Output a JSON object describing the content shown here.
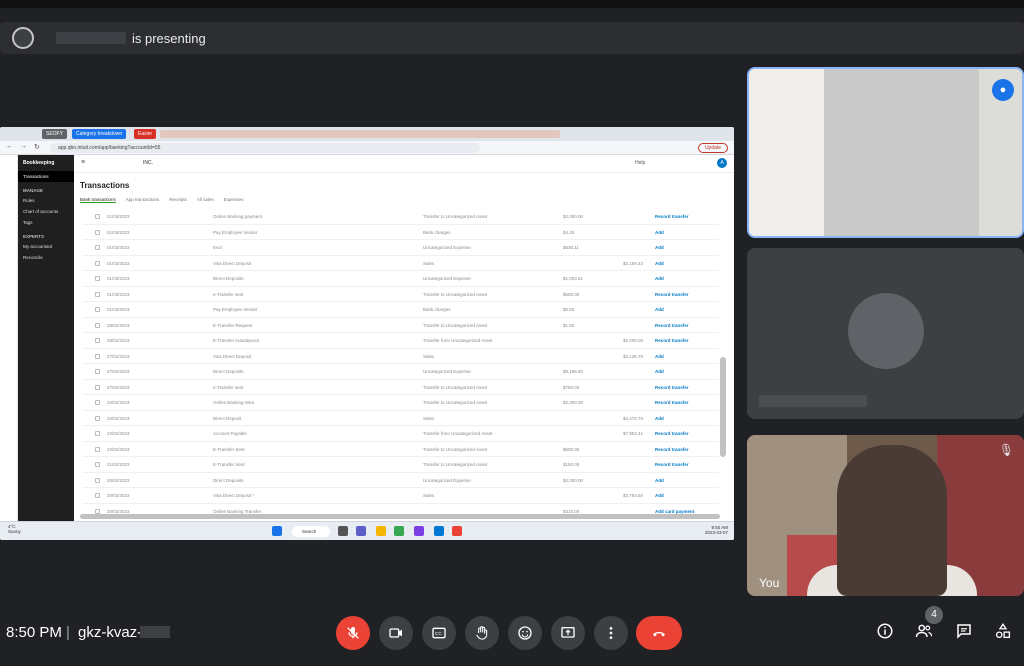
{
  "presenter": {
    "suffix": "is presenting"
  },
  "browser": {
    "tabs": [
      "SEOFY",
      "Category breakdown",
      "Easier"
    ],
    "url": "app.qbo.intuit.com/app/banking?accountId=55",
    "update_label": "Update"
  },
  "app": {
    "sidebar_title": "Bookkeeping",
    "sidebar_items": [
      "Transactions",
      "MANAGE",
      "Rules",
      "Chart of accounts",
      "Tags",
      "EXPERTS",
      "My accountant",
      "Reconcile"
    ],
    "company": "INC.",
    "help": "Help",
    "page_title": "Transactions",
    "subtabs": [
      "Bank transactions",
      "App transactions",
      "Receipts",
      "All sales",
      "Expenses"
    ],
    "rows": [
      {
        "date": "01/03/2023",
        "desc": "Online Banking payment",
        "cat": "Transfer to Uncategorized Asset",
        "spent": "$2,000.00",
        "recv": "",
        "action": "Record transfer"
      },
      {
        "date": "01/03/2023",
        "desc": "Pay Employee Vendor",
        "cat": "Bank charges",
        "spent": "$4.25",
        "recv": "",
        "action": "Add"
      },
      {
        "date": "01/03/2023",
        "desc": "Evol",
        "cat": "Uncategorized Expense",
        "spent": "$838.11",
        "recv": "",
        "action": "Add"
      },
      {
        "date": "01/03/2023",
        "desc": "Visa Direct Deposit",
        "cat": "Sales",
        "spent": "",
        "recv": "$2,159.43",
        "action": "Add"
      },
      {
        "date": "01/03/2023",
        "desc": "Direct Deposits",
        "cat": "Uncategorized Expense",
        "spent": "$1,003.61",
        "recv": "",
        "action": "Add"
      },
      {
        "date": "01/03/2023",
        "desc": "e-Transfer sent",
        "cat": "Transfer to Uncategorized Asset",
        "spent": "$600.00",
        "recv": "",
        "action": "Record transfer"
      },
      {
        "date": "01/03/2023",
        "desc": "Pay Employee Vendor",
        "cat": "Bank charges",
        "spent": "$0.83",
        "recv": "",
        "action": "Add"
      },
      {
        "date": "28/02/2023",
        "desc": "E-Transfer Request",
        "cat": "Transfer to Uncategorized Asset",
        "spent": "$1.50",
        "recv": "",
        "action": "Record transfer"
      },
      {
        "date": "28/02/2023",
        "desc": "E-Transfer Autodeposit",
        "cat": "Transfer from Uncategorized Asset",
        "spent": "",
        "recv": "$2,000.00",
        "action": "Record transfer"
      },
      {
        "date": "27/02/2023",
        "desc": "Visa Direct Deposit",
        "cat": "Sales",
        "spent": "",
        "recv": "$3,136.78",
        "action": "Add"
      },
      {
        "date": "27/02/2023",
        "desc": "Direct Deposits",
        "cat": "Uncategorized Expense",
        "spent": "$9,186.80",
        "recv": "",
        "action": "Add"
      },
      {
        "date": "27/02/2023",
        "desc": "e-Transfer sent",
        "cat": "Transfer to Uncategorized Asset",
        "spent": "$750.00",
        "recv": "",
        "action": "Record transfer"
      },
      {
        "date": "24/02/2023",
        "desc": "Online Banking Wea",
        "cat": "Transfer to Uncategorized Asset",
        "spent": "$2,000.00",
        "recv": "",
        "action": "Record transfer"
      },
      {
        "date": "24/02/2023",
        "desc": "Direct Deposit",
        "cat": "Sales",
        "spent": "",
        "recv": "$4,470.76",
        "action": "Add"
      },
      {
        "date": "22/02/2023",
        "desc": "Account Payable",
        "cat": "Transfer from Uncategorized Asset",
        "spent": "",
        "recv": "$7,953.41",
        "action": "Record transfer"
      },
      {
        "date": "22/02/2023",
        "desc": "E-Transfer Sent",
        "cat": "Transfer to Uncategorized Asset",
        "spent": "$600.00",
        "recv": "",
        "action": "Record transfer"
      },
      {
        "date": "21/02/2023",
        "desc": "E-Transfer Sent",
        "cat": "Transfer to Uncategorized Asset",
        "spent": "$150.00",
        "recv": "",
        "action": "Record transfer"
      },
      {
        "date": "20/02/2023",
        "desc": "Direct Deposits",
        "cat": "Uncategorized Expense",
        "spent": "$2,000.00",
        "recv": "",
        "action": "Add"
      },
      {
        "date": "20/02/2023",
        "desc": "Visa Direct Deposit *",
        "cat": "Sales",
        "spent": "",
        "recv": "$3,754.60",
        "action": "Add"
      },
      {
        "date": "20/02/2023",
        "desc": "Online Banking Transfer",
        "cat": "",
        "spent": "$310.00",
        "recv": "",
        "action": "Add card payment"
      }
    ]
  },
  "taskbar": {
    "temp": "4°C",
    "weather": "Sunny",
    "search": "Search",
    "clock_time": "9:50 AM",
    "clock_date": "2023-03-07"
  },
  "tiles": {
    "self_label": "You"
  },
  "footer": {
    "time": "8:50 PM",
    "separator": "|",
    "meeting_code": "gkz-kvaz-",
    "participant_count": "4"
  },
  "icons": {
    "mic_off": "mic-off-icon",
    "camera": "camera-icon",
    "captions": "captions-icon",
    "hand": "raise-hand-icon",
    "emoji": "emoji-icon",
    "present": "present-icon",
    "more": "more-icon",
    "end_call": "end-call-icon",
    "info": "info-icon",
    "people": "people-icon",
    "chat": "chat-icon",
    "activities": "activities-icon"
  },
  "colors": {
    "end_call": "#ea4335",
    "tile_border": "#8ab4f8",
    "qb_green": "#2ca01c",
    "link_blue": "#0077c5"
  }
}
